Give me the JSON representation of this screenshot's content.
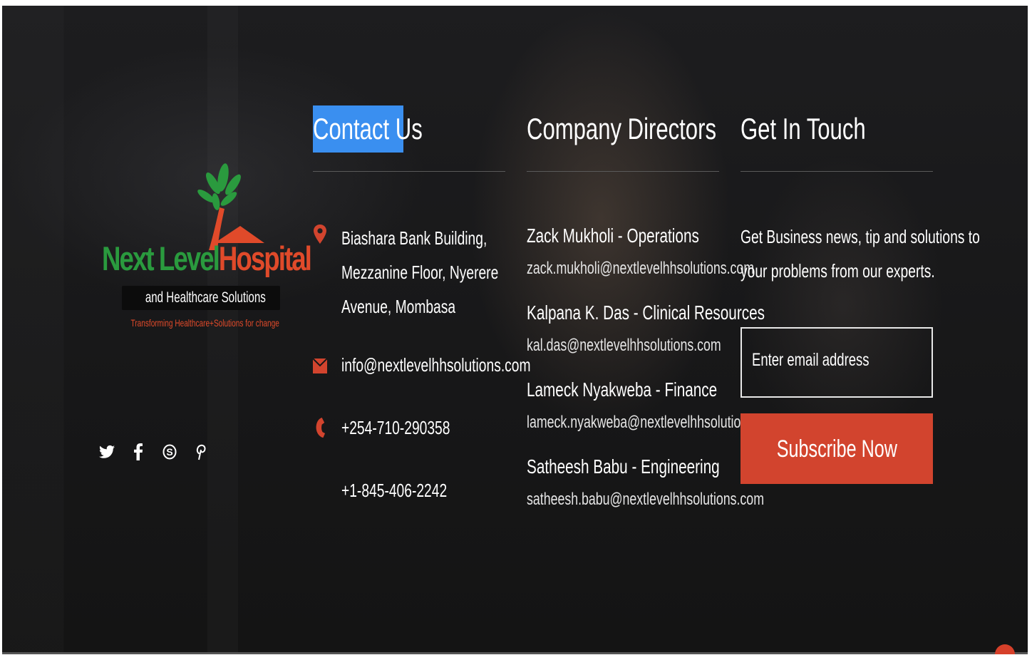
{
  "brand": {
    "logo_word_1": "Next Level",
    "logo_word_2": "Hospital",
    "logo_subtitle": "and Healthcare Solutions",
    "logo_tagline": "Transforming Healthcare+Solutions for change",
    "green": "#2a9a3e",
    "red": "#e04a2a"
  },
  "social": {
    "icons": [
      "twitter-icon",
      "facebook-icon",
      "skype-icon",
      "pinterest-icon"
    ]
  },
  "contact": {
    "title": "Contact Us",
    "address_lines": [
      "Biashara Bank Building,",
      "Mezzanine Floor, Nyerere",
      "Avenue, Mombasa"
    ],
    "email": "info@nextlevelhhsolutions.com",
    "phone_1": "+254-710-290358",
    "phone_2": "+1-845-406-2242",
    "title_highlight": "#3a8ff0"
  },
  "directors": {
    "title": "Company Directors",
    "people": [
      {
        "name": "Zack Mukholi - Operations",
        "email": "zack.mukholi@nextlevelhhsolutions.com"
      },
      {
        "name": "Kalpana K. Das - Clinical Resources",
        "email": "kal.das@nextlevelhhsolutions.com"
      },
      {
        "name": "Lameck Nyakweba - Finance",
        "email": "lameck.nyakweba@nextlevelhhsolutions.com"
      },
      {
        "name": "Satheesh Babu - Engineering",
        "email": "satheesh.babu@nextlevelhhsolutions.com"
      }
    ]
  },
  "touch": {
    "title": "Get In Touch",
    "text_lines": [
      "Get Business news, tip and solutions to",
      "your problems from our experts."
    ],
    "email_placeholder": "Enter email address",
    "subscribe_label": "Subscribe Now",
    "accent": "#d2442e"
  }
}
